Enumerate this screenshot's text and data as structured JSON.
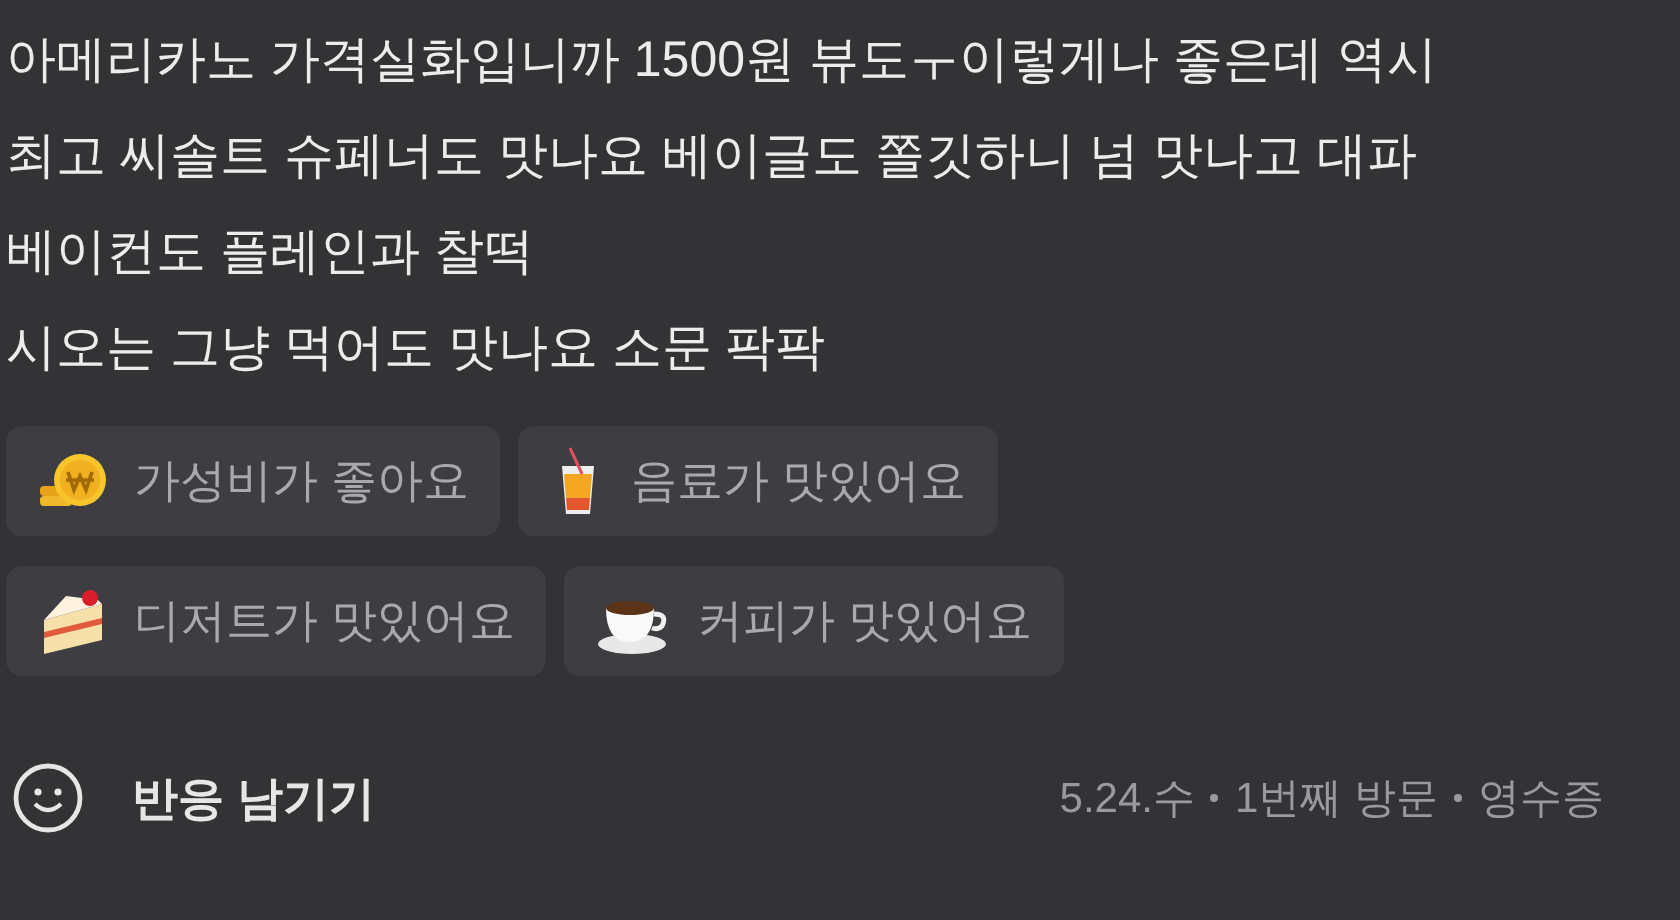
{
  "review_lines": [
    "아메리카노 가격실화입니까 1500원 뷰도ㅜ이렇게나 좋은데 역시",
    "최고 씨솔트 슈페너도 맛나요 베이글도 쫄깃하니 넘 맛나고 대파",
    "베이컨도 플레인과 찰떡",
    "시오는 그냥 먹어도 맛나요 소문 팍팍"
  ],
  "tag_rows": [
    [
      {
        "kind": "coin",
        "label": "가성비가 좋아요"
      },
      {
        "kind": "drink",
        "label": "음료가 맛있어요"
      }
    ],
    [
      {
        "kind": "cake",
        "label": "디저트가 맛있어요"
      },
      {
        "kind": "coffee",
        "label": "커피가 맛있어요"
      }
    ]
  ],
  "reaction_button": "반응 남기기",
  "meta": [
    "5.24.수",
    "1번째 방문",
    "영수증"
  ]
}
